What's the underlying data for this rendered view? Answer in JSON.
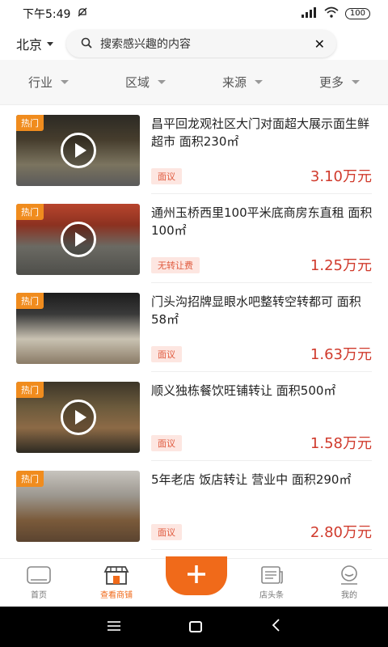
{
  "status": {
    "time": "下午5:49",
    "battery": "100"
  },
  "search": {
    "city": "北京",
    "placeholder": "搜索感兴趣的内容"
  },
  "filters": [
    "行业",
    "区域",
    "来源",
    "更多"
  ],
  "listings": [
    {
      "badge": "热门",
      "title": "昌平回龙观社区大门对面超大展示面生鲜超市 面积230㎡",
      "tag": "面议",
      "price": "3.10万元",
      "has_video": true
    },
    {
      "badge": "热门",
      "title": "通州玉桥西里100平米底商房东直租 面积100㎡",
      "tag": "无转让费",
      "price": "1.25万元",
      "has_video": true
    },
    {
      "badge": "热门",
      "title": "门头沟招牌显眼水吧整转空转都可 面积58㎡",
      "tag": "面议",
      "price": "1.63万元",
      "has_video": false
    },
    {
      "badge": "热门",
      "title": "顺义独栋餐饮旺铺转让  面积500㎡",
      "tag": "面议",
      "price": "1.58万元",
      "has_video": true
    },
    {
      "badge": "热门",
      "title": "5年老店 饭店转让 营业中 面积290㎡",
      "tag": "面议",
      "price": "2.80万元",
      "has_video": false
    }
  ],
  "tabs": [
    {
      "label": "首页",
      "icon": "home-icon"
    },
    {
      "label": "查看商铺",
      "icon": "store-icon"
    },
    {
      "label": "",
      "icon": "plus-icon"
    },
    {
      "label": "店头条",
      "icon": "news-icon"
    },
    {
      "label": "我的",
      "icon": "profile-icon"
    }
  ],
  "colors": {
    "accent": "#f06a1a",
    "price": "#d03a2c",
    "hot_badge": "#f08c1e"
  }
}
